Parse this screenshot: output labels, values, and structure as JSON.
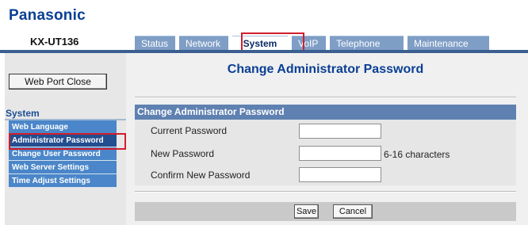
{
  "brand": "Panasonic",
  "model": "KX-UT136",
  "tabs": [
    {
      "label": "Status"
    },
    {
      "label": "Network"
    },
    {
      "label": "System"
    },
    {
      "label": "VoIP"
    },
    {
      "label": "Telephone"
    },
    {
      "label": "Maintenance"
    }
  ],
  "active_tab": "System",
  "sidebar": {
    "port_close_label": "Web Port Close",
    "section_title": "System",
    "items": [
      {
        "label": "Web Language"
      },
      {
        "label": "Administrator Password"
      },
      {
        "label": "Change User Password"
      },
      {
        "label": "Web Server Settings"
      },
      {
        "label": "Time Adjust Settings"
      }
    ],
    "active_item": "Administrator Password"
  },
  "page": {
    "title": "Change Administrator Password",
    "panel_title": "Change Administrator Password",
    "fields": [
      {
        "label": "Current Password",
        "value": ""
      },
      {
        "label": "New Password",
        "value": "",
        "hint": "6-16 characters"
      },
      {
        "label": "Confirm New Password",
        "value": ""
      }
    ]
  },
  "buttons": {
    "save": "Save",
    "cancel": "Cancel"
  },
  "colors": {
    "brand": "#0a3f94",
    "tab_bg": "#7f9ec6",
    "menu_bg": "#4a86c9",
    "panel_header": "#5f81b1",
    "highlight": "#d21e2b"
  }
}
